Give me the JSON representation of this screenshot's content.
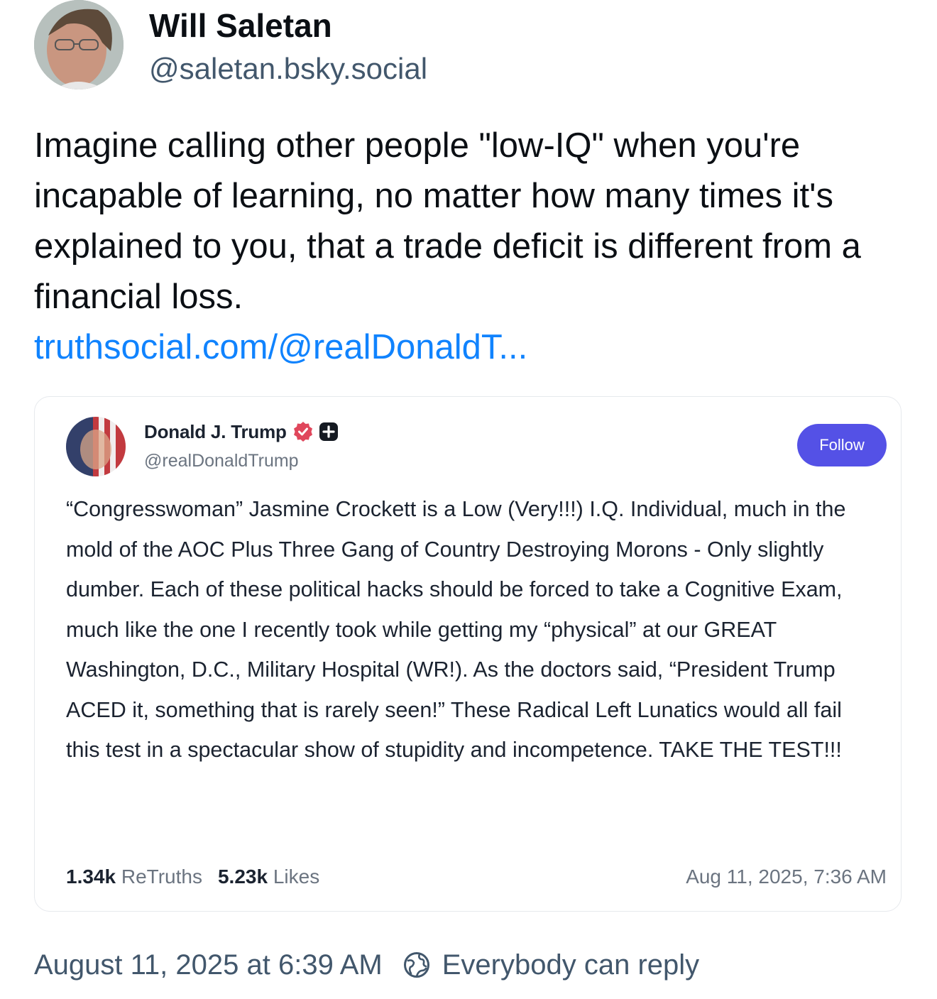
{
  "post": {
    "author_name": "Will Saletan",
    "author_handle": "@saletan.bsky.social",
    "text": "Imagine calling other people \"low-IQ\" when you're incapable of learning, no matter how many times it's explained to you, that a trade deficit is different from a financial loss.",
    "link_text": "truthsocial.com/@realDonaldT...",
    "timestamp": "August 11, 2025 at 6:39 AM",
    "reply_setting": "Everybody can reply"
  },
  "quote": {
    "author_name": "Donald J. Trump",
    "author_handle": "@realDonaldTrump",
    "follow_label": "Follow",
    "text": "“Congresswoman” Jasmine Crockett is a Low (Very!!!) I.Q. Individual, much in the mold of the AOC Plus Three Gang of Country Destroying Morons - Only slightly dumber. Each of these political hacks should be forced to take a Cognitive Exam, much like the one I recently took while getting my “physical” at our GREAT Washington, D.C., Military Hospital (WR!). As the doctors said, “President Trump ACED it, something that is rarely seen!” These Radical Left Lunatics would all fail this test in a spectacular show of stupidity and incompetence. TAKE THE TEST!!!",
    "retruths_count": "1.34k",
    "retruths_label": "ReTruths",
    "likes_count": "5.23k",
    "likes_label": "Likes",
    "date": "Aug 11, 2025, 7:36 AM"
  },
  "icons": {
    "verified": "verified-badge-icon",
    "plus": "plus-badge-icon",
    "reply": "globe-reply-icon"
  },
  "colors": {
    "link": "#1083fe",
    "follow_button": "#5451e6",
    "verified_badge": "#e0475c",
    "muted_text": "#42576c"
  }
}
